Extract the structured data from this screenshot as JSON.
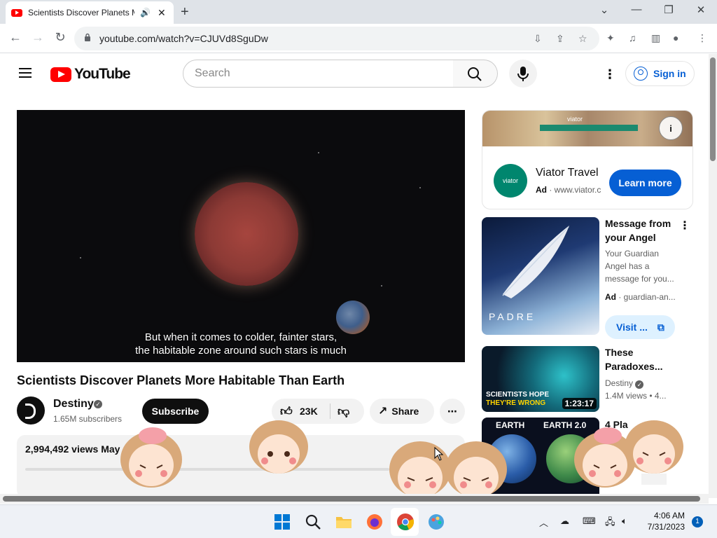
{
  "browser": {
    "tab_title": "Scientists Discover Planets M",
    "tab_close": "✕",
    "new_tab": "+",
    "url": "youtube.com/watch?v=CJUVd8SguDw"
  },
  "youtube": {
    "logo_text": "YouTube",
    "search_placeholder": "Search",
    "sign_in": "Sign in"
  },
  "video": {
    "captions": [
      "But when it comes to colder, fainter stars,",
      "the habitable zone around such stars is much"
    ],
    "title": "Scientists Discover Planets More Habitable Than Earth",
    "channel": "Destiny",
    "subscribers": "1.65M subscribers",
    "subscribe_label": "Subscribe",
    "likes": "23K",
    "share_label": "Share",
    "views_line": "2,994,492 views  May"
  },
  "sidebar": {
    "ad": {
      "banner_word": "viator",
      "logo_text": "viator",
      "title": "Viator Travel",
      "ad_label": "Ad",
      "domain": "www.viator.c",
      "cta": "Learn more"
    },
    "items": [
      {
        "title_lines": [
          "Message from",
          "your Angel"
        ],
        "desc_lines": [
          "Your Guardian",
          "Angel has a",
          "message for you..."
        ],
        "ad_label": "Ad",
        "meta": "guardian-an...",
        "thumb_text": "PADRE",
        "cta": "Visit ..."
      },
      {
        "title_lines": [
          "These",
          "Paradoxes..."
        ],
        "channel": "Destiny",
        "meta": "1.4M views  • 4...",
        "thumb_text_1": "SCIENTISTS HOPE",
        "thumb_text_2": "THEY'RE WRONG",
        "duration": "1:23:17"
      },
      {
        "title_lines": [
          "4 Pla"
        ],
        "thumb_label_left": "EARTH",
        "thumb_label_right": "EARTH 2.0"
      }
    ]
  },
  "taskbar": {
    "time": "4:06 AM",
    "date": "7/31/2023",
    "notifications": "1"
  },
  "colors": {
    "yt_red": "#ff0000",
    "link_blue": "#065fd4",
    "viator_green": "#00866e"
  }
}
